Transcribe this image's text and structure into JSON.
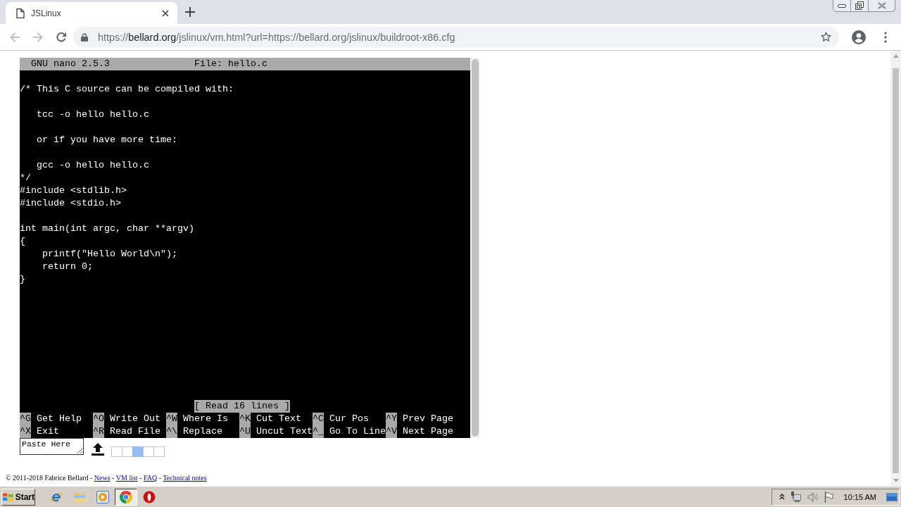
{
  "browser": {
    "tabs": [
      {
        "title": "JSLinux",
        "selected": true
      }
    ],
    "back": {
      "disabled": true
    },
    "forward": {
      "disabled": true
    },
    "address": {
      "scheme": "https://",
      "host": "bellard.org",
      "path": "/jslinux/vm.html?url=https://bellard.org/jslinux/buildroot-x86.cfg"
    }
  },
  "terminal": {
    "header": {
      "program": "GNU nano 2.5.3",
      "file": "File: hello.c"
    },
    "blocks": [
      [
        "/* This C source can be compiled with:"
      ],
      [
        "   tcc -o hello hello.c"
      ],
      [
        "   or if you have more time:"
      ],
      [
        "   gcc -o hello hello.c",
        "*/",
        "#include <stdlib.h>",
        "#include <stdio.h>"
      ],
      [
        "int main(int argc, char **argv)",
        "{",
        "    printf(\"Hello World\\n\");",
        "    return 0;",
        "}"
      ]
    ],
    "status": "[ Read 16 lines ]",
    "shortcut_rows": [
      [
        {
          "key": "^G",
          "label": "Get Help"
        },
        {
          "key": "^O",
          "label": "Write Out"
        },
        {
          "key": "^W",
          "label": "Where Is"
        },
        {
          "key": "^K",
          "label": "Cut Text"
        },
        {
          "key": "^C",
          "label": "Cur Pos"
        },
        {
          "key": "^Y",
          "label": "Prev Page"
        }
      ],
      [
        {
          "key": "^X",
          "label": "Exit"
        },
        {
          "key": "^R",
          "label": "Read File"
        },
        {
          "key": "^\\",
          "label": "Replace"
        },
        {
          "key": "^U",
          "label": "Uncut Text"
        },
        {
          "key": "^_",
          "label": "Go To Line"
        },
        {
          "key": "^V",
          "label": "Next Page"
        }
      ]
    ]
  },
  "below_terminal": {
    "paste_box": {
      "value": "Paste Here"
    },
    "indicator": [
      {
        "on": false
      },
      {
        "on": false
      },
      {
        "on": true
      },
      {
        "on": false
      },
      {
        "on": false
      }
    ]
  },
  "footer": {
    "copyright": "© 2011-2018 Fabrice Bellard",
    "separator": "-",
    "links": [
      "News",
      "VM list",
      "FAQ",
      "Technical notes"
    ]
  },
  "taskbar": {
    "start": "Start",
    "apps": [
      {
        "selected": false
      },
      {
        "selected": false
      },
      {
        "selected": false
      },
      {
        "selected": true
      },
      {
        "selected": false
      }
    ],
    "clock": "10:15 AM"
  }
}
